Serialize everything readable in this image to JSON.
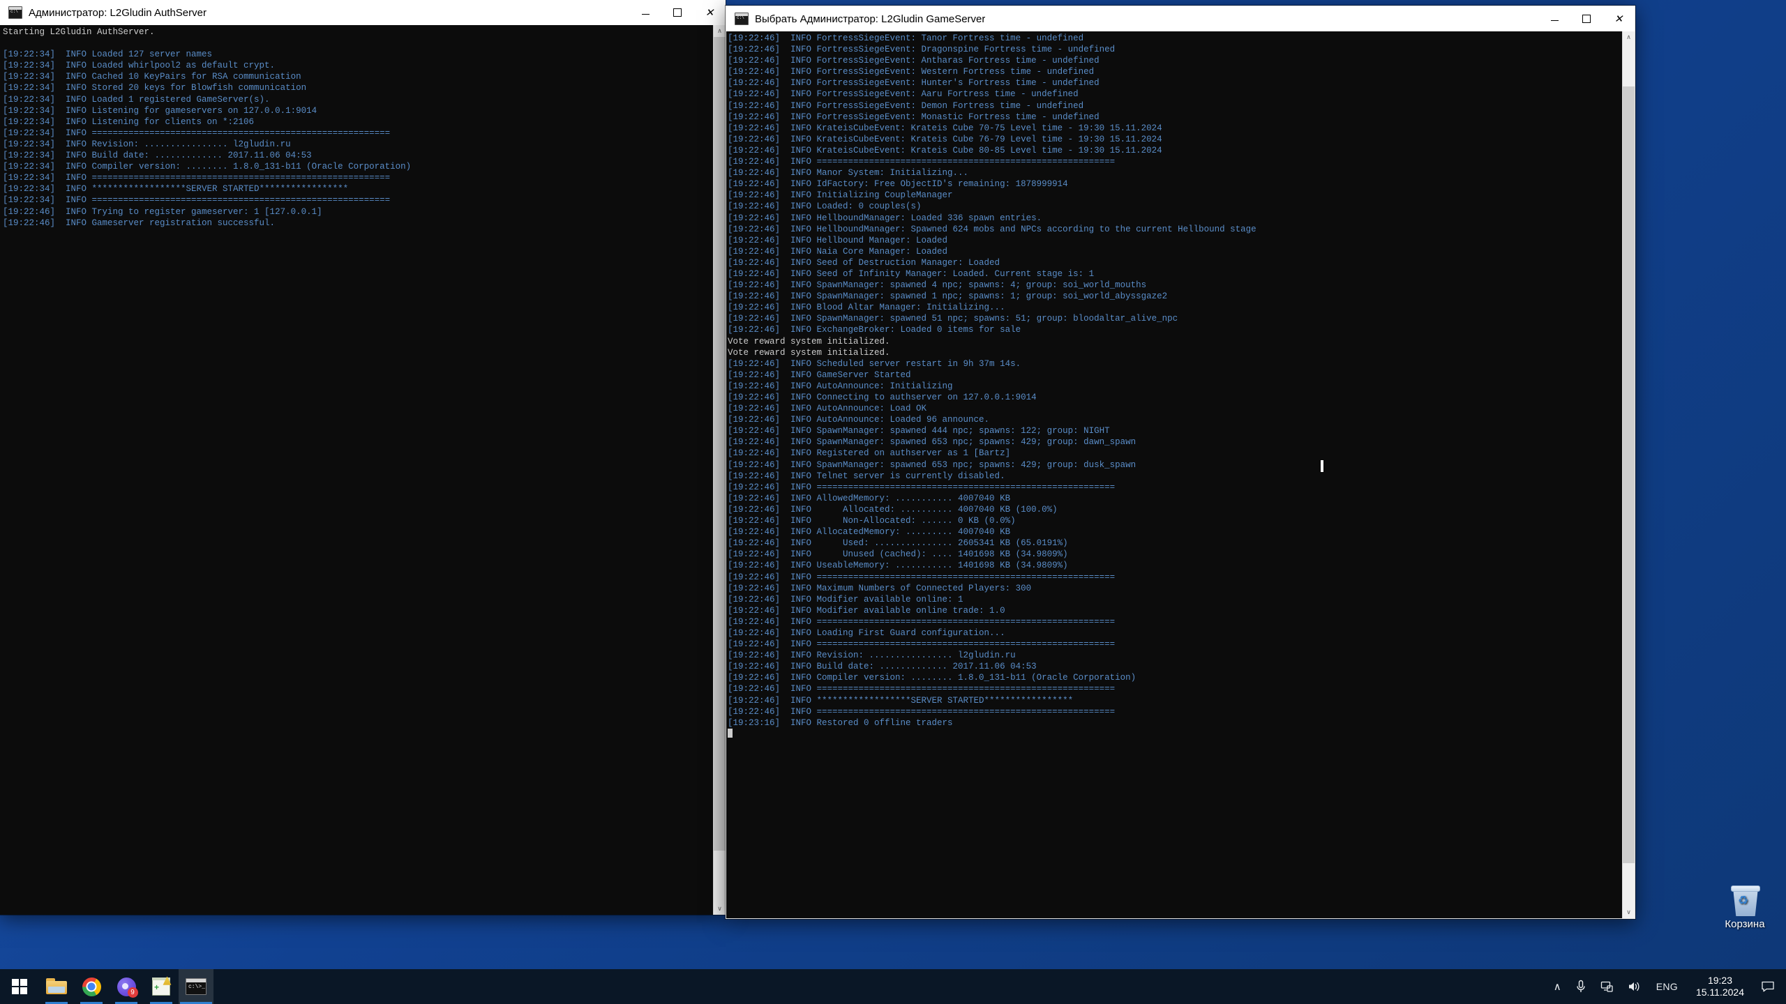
{
  "desktop": {
    "background_color": "#14489c",
    "icons": [
      {
        "name": "recycle-bin",
        "label": "Корзина",
        "icon": "recycle-bin-icon"
      }
    ]
  },
  "auth_window": {
    "title": "Администратор: L2Gludin AuthServer",
    "icon": "cmd-icon",
    "controls": {
      "minimize": "–",
      "maximize": "☐",
      "close": "✕"
    },
    "scrollbar": {
      "up_arrow": "∧",
      "down_arrow": "∨"
    },
    "lines": [
      "Starting L2Gludin AuthServer.",
      "",
      "[19:22:34]  INFO Loaded 127 server names",
      "[19:22:34]  INFO Loaded whirlpool2 as default crypt.",
      "[19:22:34]  INFO Cached 10 KeyPairs for RSA communication",
      "[19:22:34]  INFO Stored 20 keys for Blowfish communication",
      "[19:22:34]  INFO Loaded 1 registered GameServer(s).",
      "[19:22:34]  INFO Listening for gameservers on 127.0.0.1:9014",
      "[19:22:34]  INFO Listening for clients on *:2106",
      "[19:22:34]  INFO =========================================================",
      "[19:22:34]  INFO Revision: ................ l2gludin.ru",
      "[19:22:34]  INFO Build date: ............. 2017.11.06 04:53",
      "[19:22:34]  INFO Compiler version: ........ 1.8.0_131-b11 (Oracle Corporation)",
      "[19:22:34]  INFO =========================================================",
      "[19:22:34]  INFO ******************SERVER STARTED*****************",
      "[19:22:34]  INFO =========================================================",
      "[19:22:46]  INFO Trying to register gameserver: 1 [127.0.0.1]",
      "[19:22:46]  INFO Gameserver registration successful."
    ]
  },
  "game_window": {
    "title": "Выбрать Администратор: L2Gludin GameServer",
    "icon": "cmd-icon",
    "controls": {
      "minimize": "–",
      "maximize": "☐",
      "close": "✕"
    },
    "scrollbar": {
      "up_arrow": "∧",
      "down_arrow": "∨"
    },
    "lines": [
      "[19:22:46]  INFO FortressSiegeEvent: Tanor Fortress time - undefined",
      "[19:22:46]  INFO FortressSiegeEvent: Dragonspine Fortress time - undefined",
      "[19:22:46]  INFO FortressSiegeEvent: Antharas Fortress time - undefined",
      "[19:22:46]  INFO FortressSiegeEvent: Western Fortress time - undefined",
      "[19:22:46]  INFO FortressSiegeEvent: Hunter's Fortress time - undefined",
      "[19:22:46]  INFO FortressSiegeEvent: Aaru Fortress time - undefined",
      "[19:22:46]  INFO FortressSiegeEvent: Demon Fortress time - undefined",
      "[19:22:46]  INFO FortressSiegeEvent: Monastic Fortress time - undefined",
      "[19:22:46]  INFO KrateisCubeEvent: Krateis Cube 70-75 Level time - 19:30 15.11.2024",
      "[19:22:46]  INFO KrateisCubeEvent: Krateis Cube 76-79 Level time - 19:30 15.11.2024",
      "[19:22:46]  INFO KrateisCubeEvent: Krateis Cube 80-85 Level time - 19:30 15.11.2024",
      "[19:22:46]  INFO =========================================================",
      "[19:22:46]  INFO Manor System: Initializing...",
      "[19:22:46]  INFO IdFactory: Free ObjectID's remaining: 1878999914",
      "[19:22:46]  INFO Initializing CoupleManager",
      "[19:22:46]  INFO Loaded: 0 couples(s)",
      "[19:22:46]  INFO HellboundManager: Loaded 336 spawn entries.",
      "[19:22:46]  INFO HellboundManager: Spawned 624 mobs and NPCs according to the current Hellbound stage",
      "[19:22:46]  INFO Hellbound Manager: Loaded",
      "[19:22:46]  INFO Naia Core Manager: Loaded",
      "[19:22:46]  INFO Seed of Destruction Manager: Loaded",
      "[19:22:46]  INFO Seed of Infinity Manager: Loaded. Current stage is: 1",
      "[19:22:46]  INFO SpawnManager: spawned 4 npc; spawns: 4; group: soi_world_mouths",
      "[19:22:46]  INFO SpawnManager: spawned 1 npc; spawns: 1; group: soi_world_abyssgaze2",
      "[19:22:46]  INFO Blood Altar Manager: Initializing...",
      "[19:22:46]  INFO SpawnManager: spawned 51 npc; spawns: 51; group: bloodaltar_alive_npc",
      "[19:22:46]  INFO ExchangeBroker: Loaded 0 items for sale",
      "Vote reward system initialized.",
      "Vote reward system initialized.",
      "[19:22:46]  INFO Scheduled server restart in 9h 37m 14s.",
      "[19:22:46]  INFO GameServer Started",
      "[19:22:46]  INFO AutoAnnounce: Initializing",
      "[19:22:46]  INFO Connecting to authserver on 127.0.0.1:9014",
      "[19:22:46]  INFO AutoAnnounce: Load OK",
      "[19:22:46]  INFO AutoAnnounce: Loaded 96 announce.",
      "[19:22:46]  INFO SpawnManager: spawned 444 npc; spawns: 122; group: NIGHT",
      "[19:22:46]  INFO SpawnManager: spawned 653 npc; spawns: 429; group: dawn_spawn",
      "[19:22:46]  INFO Registered on authserver as 1 [Bartz]",
      "[19:22:46]  INFO SpawnManager: spawned 653 npc; spawns: 429; group: dusk_spawn",
      "[19:22:46]  INFO Telnet server is currently disabled.",
      "[19:22:46]  INFO =========================================================",
      "[19:22:46]  INFO AllowedMemory: ........... 4007040 KB",
      "[19:22:46]  INFO      Allocated: .......... 4007040 KB (100.0%)",
      "[19:22:46]  INFO      Non-Allocated: ...... 0 KB (0.0%)",
      "[19:22:46]  INFO AllocatedMemory: ......... 4007040 KB",
      "[19:22:46]  INFO      Used: ............... 2605341 KB (65.0191%)",
      "[19:22:46]  INFO      Unused (cached): .... 1401698 KB (34.9809%)",
      "[19:22:46]  INFO UseableMemory: ........... 1401698 KB (34.9809%)",
      "[19:22:46]  INFO =========================================================",
      "[19:22:46]  INFO Maximum Numbers of Connected Players: 300",
      "[19:22:46]  INFO Modifier available online: 1",
      "[19:22:46]  INFO Modifier available online trade: 1.0",
      "[19:22:46]  INFO =========================================================",
      "[19:22:46]  INFO Loading First Guard configuration...",
      "[19:22:46]  INFO =========================================================",
      "[19:22:46]  INFO Revision: ................ l2gludin.ru",
      "[19:22:46]  INFO Build date: ............. 2017.11.06 04:53",
      "[19:22:46]  INFO Compiler version: ........ 1.8.0_131-b11 (Oracle Corporation)",
      "[19:22:46]  INFO =========================================================",
      "[19:22:46]  INFO ******************SERVER STARTED*****************",
      "[19:22:46]  INFO =========================================================",
      "[19:23:16]  INFO Restored 0 offline traders"
    ]
  },
  "taskbar": {
    "background_color": "#0a1726",
    "items": [
      {
        "name": "start-button",
        "icon": "windows-logo-icon",
        "label": ""
      },
      {
        "name": "file-explorer",
        "icon": "folder-icon",
        "label": ""
      },
      {
        "name": "google-chrome",
        "icon": "chrome-icon",
        "label": ""
      },
      {
        "name": "messenger",
        "icon": "chat-icon",
        "label": "",
        "badge": "9"
      },
      {
        "name": "notepad-plus-plus",
        "icon": "notepad-icon",
        "label": ""
      },
      {
        "name": "command-prompt",
        "icon": "cmd-icon",
        "label": ""
      }
    ],
    "tray": {
      "show_hidden": "∧",
      "microphone": "microphone-icon",
      "network": "network-icon",
      "volume": "volume-icon",
      "language": "ENG",
      "clock_time": "19:23",
      "clock_date": "15.11.2024",
      "action_center": "speech-bubble-icon"
    }
  }
}
